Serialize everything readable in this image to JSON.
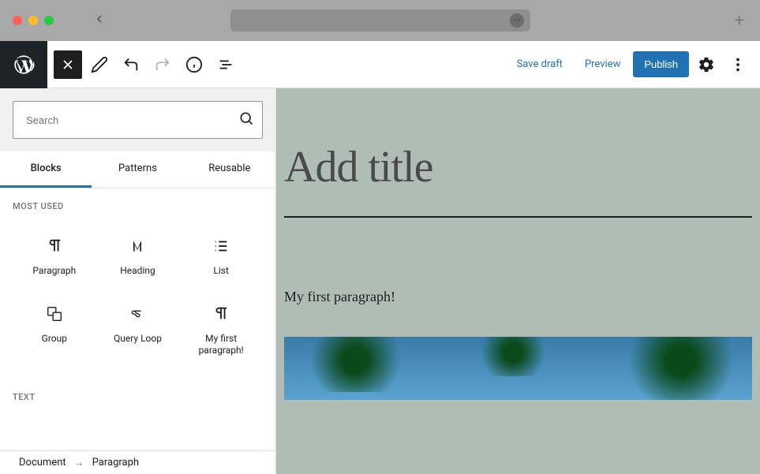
{
  "header": {
    "save_draft": "Save draft",
    "preview": "Preview",
    "publish": "Publish"
  },
  "inserter": {
    "search_placeholder": "Search",
    "tabs": {
      "blocks": "Blocks",
      "patterns": "Patterns",
      "reusable": "Reusable"
    },
    "sections": {
      "most_used": "MOST USED",
      "text": "TEXT"
    },
    "blocks": {
      "paragraph": "Paragraph",
      "heading": "Heading",
      "list": "List",
      "group": "Group",
      "query_loop": "Query Loop",
      "my_first_paragraph": "My first paragraph!"
    }
  },
  "breadcrumb": {
    "document": "Document",
    "current": "Paragraph"
  },
  "canvas": {
    "title_placeholder": "Add title",
    "paragraph": "My first paragraph!"
  }
}
